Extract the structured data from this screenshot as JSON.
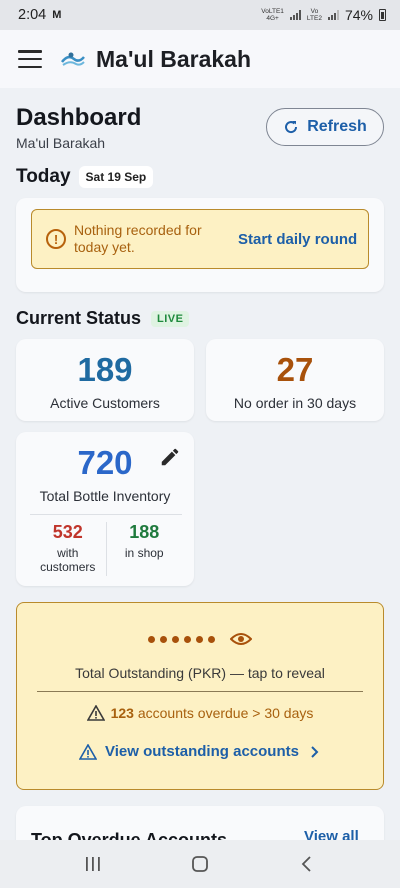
{
  "status_bar": {
    "time": "2:04",
    "notification_icon": "gmail-icon",
    "sim1_label": "VoLTE1 4G+",
    "sim2_label": "VoLTE2",
    "battery": "74%"
  },
  "app_bar": {
    "title": "Ma'ul Barakah",
    "menu_icon": "menu-icon",
    "logo_icon": "brand-logo"
  },
  "dashboard": {
    "title": "Dashboard",
    "subtitle": "Ma'ul Barakah",
    "refresh_label": "Refresh"
  },
  "today": {
    "label": "Today",
    "date": "Sat 19 Sep",
    "warning": "Nothing recorded for today yet.",
    "action": "Start daily round"
  },
  "current_status": {
    "title": "Current Status",
    "live": "LIVE",
    "active_customers": {
      "value": "189",
      "label": "Active Customers",
      "color": "#1f6aa1"
    },
    "no_order": {
      "value": "27",
      "label": "No order in 30 days",
      "color": "#a8510b"
    },
    "inventory": {
      "value": "720",
      "label": "Total Bottle Inventory",
      "with_customers": {
        "value": "532",
        "label": "with customers",
        "color": "#c0352b"
      },
      "in_shop": {
        "value": "188",
        "label": "in shop",
        "color": "#1f7a3d"
      }
    }
  },
  "outstanding": {
    "masked_value": "••••••",
    "label": "Total Outstanding (PKR) — tap to reveal",
    "overdue_count": "123",
    "overdue_text": "accounts overdue > 30 days",
    "view_link": "View outstanding accounts"
  },
  "top_overdue": {
    "title": "Top Overdue Accounts",
    "view_all": "View all"
  },
  "colors": {
    "accent": "#1d5fa8",
    "warning_bg": "#fdf1c4",
    "warning_border": "#b98b2c"
  }
}
